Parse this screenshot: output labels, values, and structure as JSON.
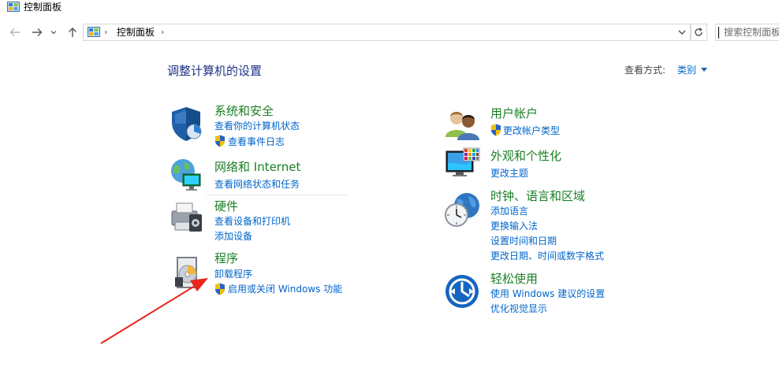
{
  "window": {
    "title": "控制面板"
  },
  "address": {
    "separator": "›",
    "path": "控制面板",
    "trail": "›"
  },
  "search": {
    "placeholder": "搜索控制面板"
  },
  "main": {
    "heading": "调整计算机的设置",
    "view_by_label": "查看方式:",
    "view_by_value": "类别"
  },
  "categories": [
    {
      "title": "系统和安全",
      "links": [
        "查看你的计算机状态",
        "查看事件日志"
      ]
    },
    {
      "title": "网络和 Internet",
      "links": [
        "查看网络状态和任务"
      ]
    },
    {
      "title": "硬件",
      "links": [
        "查看设备和打印机",
        "添加设备"
      ]
    },
    {
      "title": "程序",
      "links": [
        "卸载程序",
        "启用或关闭 Windows 功能"
      ]
    },
    {
      "title": "用户帐户",
      "links": [
        "更改帐户类型"
      ]
    },
    {
      "title": "外观和个性化",
      "links": [
        "更改主题"
      ]
    },
    {
      "title": "时钟、语言和区域",
      "links": [
        "添加语言",
        "更换输入法",
        "设置时间和日期",
        "更改日期、时间或数字格式"
      ]
    },
    {
      "title": "轻松使用",
      "links": [
        "使用 Windows 建议的设置",
        "优化视觉显示"
      ]
    }
  ],
  "colors": {
    "heading": "#1e3287",
    "category": "#1a7f23",
    "link": "#0066cc",
    "annotation_arrow": "#e8261e"
  }
}
